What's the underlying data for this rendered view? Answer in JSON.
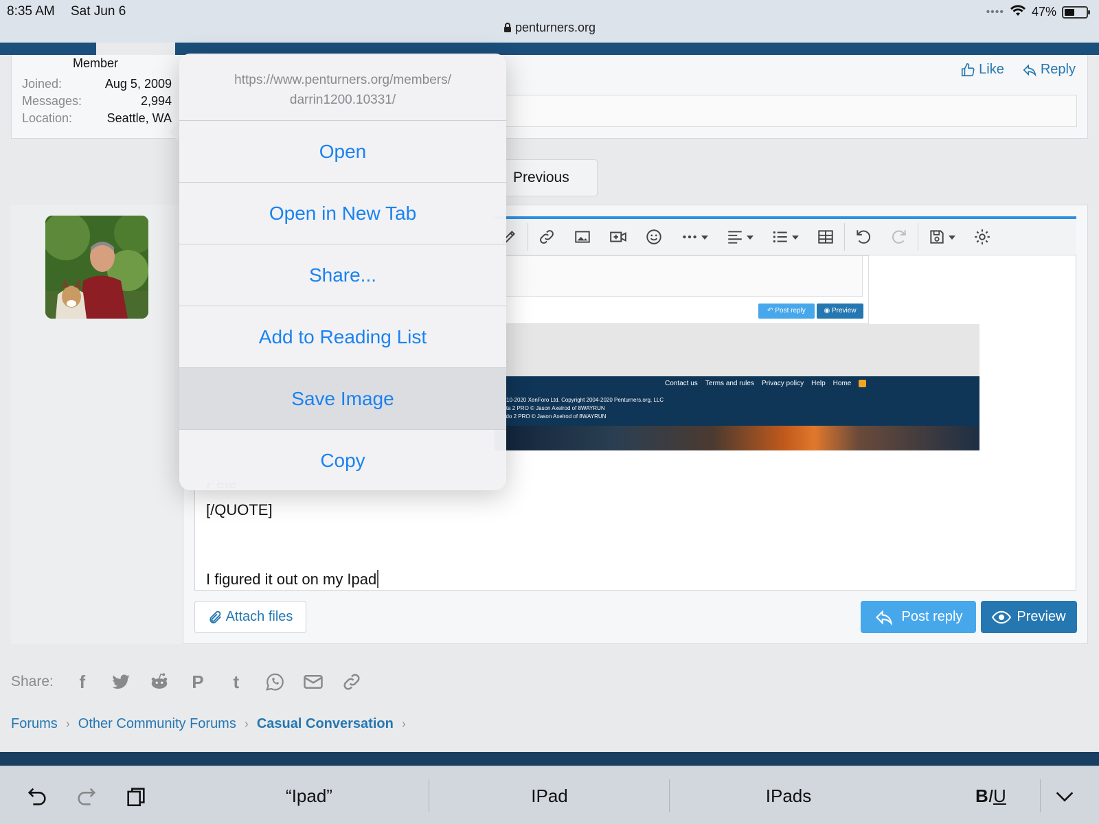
{
  "status_bar": {
    "time": "8:35 AM",
    "date": "Sat Jun 6",
    "battery": "47%",
    "battery_level": 0.47,
    "url": "penturners.org"
  },
  "member": {
    "title": "Member",
    "stats": [
      {
        "label": "Joined:",
        "value": "Aug 5, 2009"
      },
      {
        "label": "Messages:",
        "value": "2,994"
      },
      {
        "label": "Location:",
        "value": "Seattle, WA"
      }
    ]
  },
  "post_actions": {
    "like": "Like",
    "reply": "Reply"
  },
  "pagination": {
    "previous": "Previous"
  },
  "embedded_image": {
    "post_reply": "Post reply",
    "preview": "Preview",
    "footer_links": [
      "Contact us",
      "Terms and rules",
      "Privacy policy",
      "Help",
      "Home"
    ],
    "copyright": [
      "© 2010-2020 XenForo Ltd. Copyright 2004-2020 Penturners.org, LLC",
      "nPorta 2 PRO © Jason Axelrod of 8WAYRUN",
      "Atendo 2 PRO © Jason Axelrod of 8WAYRUN"
    ]
  },
  "editor": {
    "quote_partial": "Pete",
    "quote_end": "[/QUOTE]",
    "typed_text": "I figured it out on my Ipad",
    "attach": "Attach files",
    "post_reply": "Post reply",
    "preview": "Preview"
  },
  "share": {
    "label": "Share:",
    "icons": [
      "facebook-icon",
      "twitter-icon",
      "reddit-icon",
      "pinterest-icon",
      "tumblr-icon",
      "whatsapp-icon",
      "email-icon",
      "link-icon"
    ]
  },
  "breadcrumb": [
    "Forums",
    "Other Community Forums",
    "Casual Conversation"
  ],
  "context_menu": {
    "url": "https://www.penturners.org/members/darrin1200.10331/",
    "url_line1": "https://www.penturners.org/members/",
    "url_line2": "darrin1200.10331/",
    "items": [
      "Open",
      "Open in New Tab",
      "Share...",
      "Add to Reading List",
      "Save Image",
      "Copy"
    ],
    "highlighted": "Save Image"
  },
  "keyboard": {
    "suggestions": [
      "“Ipad”",
      "IPad",
      "IPads"
    ],
    "format_b": "B",
    "format_i": "I",
    "format_u": "U"
  },
  "colors": {
    "link": "#2577b1",
    "menu_text": "#1a82f0",
    "nav": "#1b4f7c",
    "post_button": "#47a7eb"
  }
}
